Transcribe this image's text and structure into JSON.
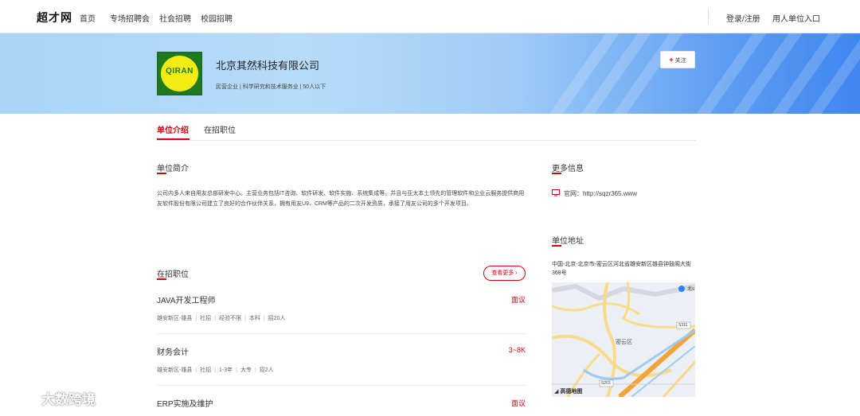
{
  "nav": {
    "logo": "超才网",
    "items": [
      "首页",
      "专场招聘会",
      "社会招聘",
      "校园招聘"
    ],
    "login": "登录/注册",
    "employer": "用人单位入口"
  },
  "company": {
    "logo_text": "QIRAN",
    "name": "北京其然科技有限公司",
    "tags": "民营企业 | 科学研究和技术服务业 | 50人以下",
    "follow": "关注"
  },
  "tabs": [
    "单位介绍",
    "在招职位"
  ],
  "intro": {
    "title": "单位简介",
    "text": "公司内多人来自用友总部研发中心。主营业务包括IT咨询、软件研发、软件实施、系统集成等。并且与亚太本土领先的管理软件和企业云服务提供商用友软件股份有限公司建立了良好的合作伙伴关系，拥有用友U9、CRM等产品的二次开发资质，承接了用友公司的多个开发项目。"
  },
  "jobs": {
    "title": "在招职位",
    "more": "查看更多",
    "items": [
      {
        "title": "JAVA开发工程师",
        "salary": "面议",
        "location": "雄安新区-雄县",
        "type": "社招",
        "exp": "经验不限",
        "edu": "本科",
        "count": "招20人"
      },
      {
        "title": "财务会计",
        "salary": "3~8K",
        "location": "雄安新区-雄县",
        "type": "社招",
        "exp": "1-3年",
        "edu": "大专",
        "count": "招2人"
      },
      {
        "title": "ERP实施及维护",
        "salary": "面议"
      }
    ]
  },
  "more_info": {
    "title": "更多信息",
    "site_label": "官网：",
    "site": "http://sqzr365.www"
  },
  "address": {
    "title": "单位地址",
    "text": "中国-北京-北京市-密云区河北省雄安新区雄县钟鼓阁大街368号"
  },
  "map": {
    "label_district": "密云区",
    "road_s311": "S311",
    "road_s203": "S203",
    "corner_label": "北s",
    "provider": "高德地图"
  },
  "watermark": "大数跨境",
  "colors": {
    "accent": "#d6000f",
    "banner_start": "#a7d4f7",
    "banner_end": "#3f86ef"
  }
}
